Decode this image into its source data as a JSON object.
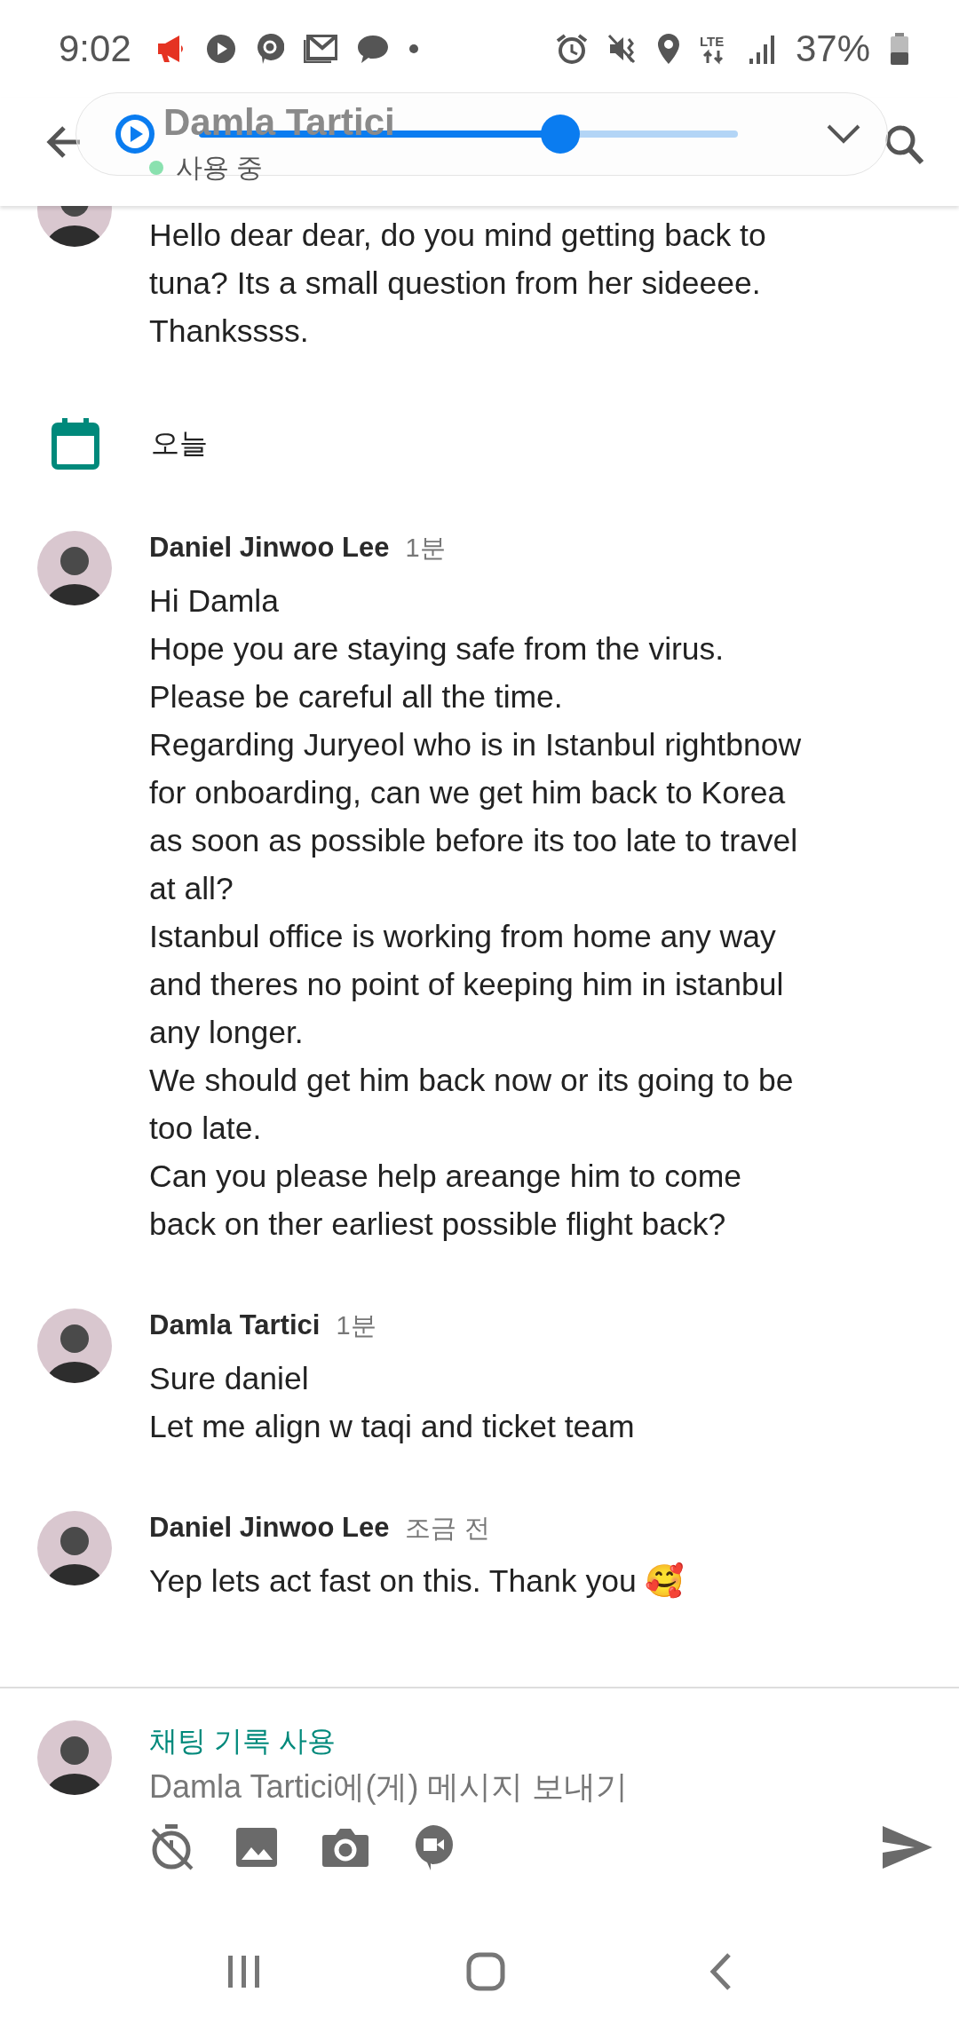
{
  "status_bar": {
    "time": "9:02",
    "network": "LTE",
    "battery": "37%"
  },
  "header": {
    "title": "Damla Tartici",
    "presence": "사용 중"
  },
  "media_player": {
    "level": 0.67
  },
  "feed": [
    {
      "kind": "message",
      "lines": [
        "Hello dear dear, do you mind getting back to",
        "tuna? Its a small question from her sideeee.",
        "Thankssss."
      ]
    },
    {
      "kind": "date",
      "label": "오늘"
    },
    {
      "kind": "message",
      "author": "Daniel Jinwoo Lee",
      "time": "1분",
      "lines": [
        "Hi Damla",
        "Hope you are staying safe from the virus.",
        "Please be careful all the time.",
        "Regarding Juryeol who is in Istanbul rightbnow",
        "for onboarding, can we get him back to Korea",
        "as soon as possible before its too late to travel",
        "at all?",
        "Istanbul office is working from home any way",
        "and theres no point of keeping him in istanbul",
        "any longer.",
        "We should get him back now or its going to be",
        "too late.",
        "Can you please help areange him to come",
        "back on ther earliest possible flight back?"
      ]
    },
    {
      "kind": "message",
      "author": "Damla Tartici",
      "time": "1분",
      "lines": [
        "Sure daniel",
        "Let me align w taqi and ticket team"
      ]
    },
    {
      "kind": "message",
      "author": "Daniel Jinwoo Lee",
      "time": "조금 전",
      "lines": [
        "Yep lets act fast on this. Thank you 🥰"
      ]
    }
  ],
  "composer": {
    "history_label": "채팅 기록 사용",
    "placeholder": "Damla Tartici에(게) 메시지 보내기"
  }
}
